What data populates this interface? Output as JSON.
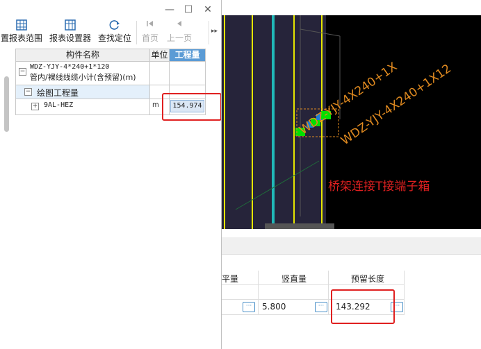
{
  "toolbar": {
    "items": [
      {
        "label": "置报表范围",
        "icon": "grid-icon"
      },
      {
        "label": "报表设置器",
        "icon": "grid-settings-icon"
      },
      {
        "label": "查找定位",
        "icon": "refresh-locate-icon"
      },
      {
        "label": "首页",
        "icon": "first-page-icon"
      },
      {
        "label": "上一页",
        "icon": "prev-page-icon"
      }
    ]
  },
  "window": {
    "minimize": "—",
    "maximize": "☐",
    "close": "✕"
  },
  "table": {
    "headers": [
      "构件名称",
      "单位",
      "工程量"
    ],
    "group_line1": "WDZ-YJY-4*240+1*120",
    "group_line2": "管内/裸线线缆小计(含预留)(m)",
    "subgroup": "绘图工程量",
    "row": {
      "name": "9AL-HEZ",
      "unit": "m",
      "value": "154.974"
    }
  },
  "canvas": {
    "cable_label_1": "WDZ-YJY-4X240+1X",
    "cable_label_2": "WDZ-YJY-4X240+1X12",
    "annotation": "桥架连接T接端子箱"
  },
  "bottom_grid": {
    "headers": [
      "平量",
      "竖直量",
      "预留长度"
    ],
    "values": {
      "vertical": "5.800",
      "reserved": "143.292"
    },
    "button_label": "···"
  }
}
